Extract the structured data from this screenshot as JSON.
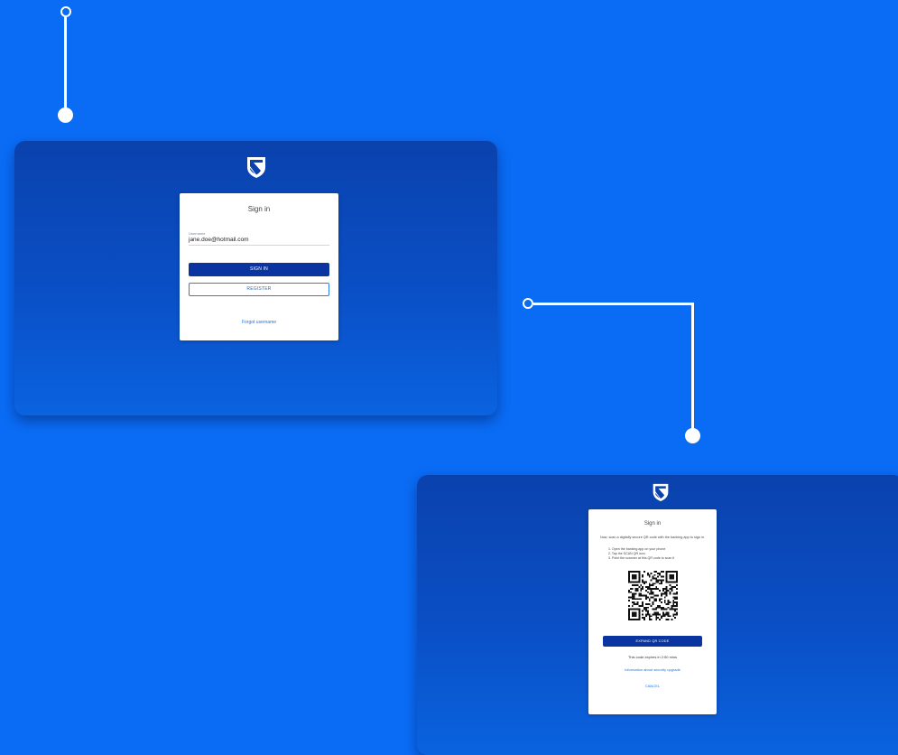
{
  "screen1": {
    "title": "Sign in",
    "username_label": "Username",
    "username_value": "jane.doe@hotmail.com",
    "signin_label": "SIGN IN",
    "register_label": "REGISTER",
    "forgot_label": "Forgot username"
  },
  "screen2": {
    "title": "Sign in",
    "description": "Now, scan a digitally secure QR code with the banking app to sign in.",
    "steps": [
      "1.  Open the banking app on your phone",
      "2.  Tap the SCAN QR icon.",
      "3.  Point the scanner at this QR code to scan it"
    ],
    "expand_label": "EXPAND QR CODE",
    "expiry": "This code expires in 2:50 mins",
    "info_link": "Information about security upgrade",
    "cancel_label": "CANCEL"
  },
  "colors": {
    "background": "#0a6cf5",
    "panel_top": "#0a42ad",
    "primary_button": "#0a34a0",
    "link": "#1a73e8"
  },
  "icons": [
    "bank-shield-logo-icon",
    "qr-code-icon"
  ]
}
